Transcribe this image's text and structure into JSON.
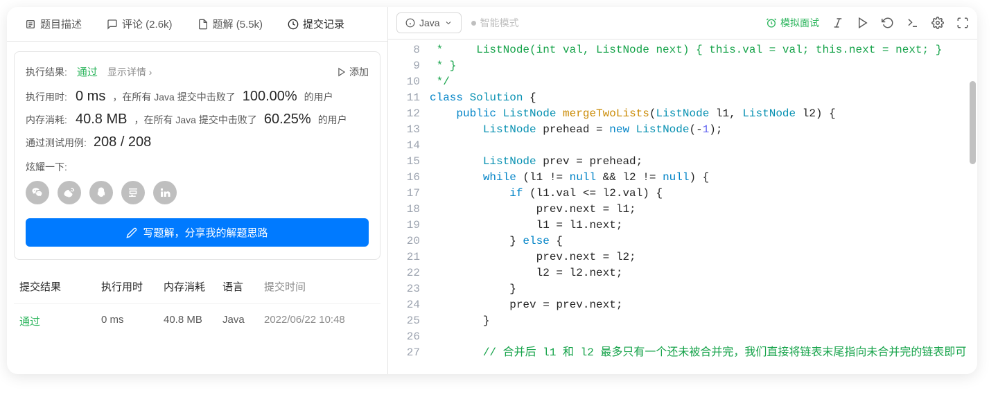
{
  "tabs": {
    "description": "题目描述",
    "comments": "评论 (2.6k)",
    "solutions": "题解 (5.5k)",
    "submissions": "提交记录"
  },
  "result": {
    "label": "执行结果:",
    "status": "通过",
    "detail": "显示详情 ›",
    "add": "添加",
    "runtime_label": "执行用时:",
    "runtime_value": "0 ms",
    "runtime_mid": "，在所有 Java 提交中击败了",
    "runtime_pct": "100.00%",
    "runtime_sfx": "的用户",
    "memory_label": "内存消耗:",
    "memory_value": "40.8 MB",
    "memory_mid": "，在所有 Java 提交中击败了",
    "memory_pct": "60.25%",
    "memory_sfx": "的用户",
    "tests_label": "通过测试用例:",
    "tests_value": "208 / 208",
    "share_label": "炫耀一下:",
    "write_button": "写题解，分享我的解题思路"
  },
  "share_icons": [
    "wechat",
    "weibo",
    "qq",
    "douban",
    "linkedin"
  ],
  "history": {
    "headers": {
      "result": "提交结果",
      "time": "执行用时",
      "mem": "内存消耗",
      "lang": "语言",
      "date": "提交时间"
    },
    "rows": [
      {
        "result": "通过",
        "time": "0 ms",
        "mem": "40.8 MB",
        "lang": "Java",
        "date": "2022/06/22 10:48"
      }
    ]
  },
  "editor": {
    "language": "Java",
    "smart_mode": "智能模式",
    "mock_interview": "模拟面试",
    "line_start": 8,
    "lines": [
      {
        "html": "<span class='c-comment'> *     ListNode(int val, ListNode next) { this.val = val; this.next = next; }</span>"
      },
      {
        "html": "<span class='c-comment'> * }</span>"
      },
      {
        "html": "<span class='c-comment'> */</span>"
      },
      {
        "html": "<span class='c-keyword'>class</span> <span class='c-type'>Solution</span> {"
      },
      {
        "html": "    <span class='c-keyword'>public</span> <span class='c-type'>ListNode</span> <span class='c-method'>mergeTwoLists</span>(<span class='c-type'>ListNode</span> l1, <span class='c-type'>ListNode</span> l2) {"
      },
      {
        "html": "        <span class='c-type'>ListNode</span> prehead = <span class='c-keyword'>new</span> <span class='c-type'>ListNode</span>(-<span class='c-number'>1</span>);"
      },
      {
        "html": ""
      },
      {
        "html": "        <span class='c-type'>ListNode</span> prev = prehead;"
      },
      {
        "html": "        <span class='c-keyword'>while</span> (l1 != <span class='c-keyword'>null</span> && l2 != <span class='c-keyword'>null</span>) {"
      },
      {
        "html": "            <span class='c-keyword'>if</span> (l1.val <= l2.val) {"
      },
      {
        "html": "                prev.next = l1;"
      },
      {
        "html": "                l1 = l1.next;"
      },
      {
        "html": "            } <span class='c-keyword'>else</span> {"
      },
      {
        "html": "                prev.next = l2;"
      },
      {
        "html": "                l2 = l2.next;"
      },
      {
        "html": "            }"
      },
      {
        "html": "            prev = prev.next;"
      },
      {
        "html": "        }"
      },
      {
        "html": ""
      },
      {
        "html": "        <span class='c-comment'>// 合并后 l1 和 l2 最多只有一个还未被合并完，我们直接将链表末尾指向未合并完的链表即可</span>"
      }
    ]
  }
}
